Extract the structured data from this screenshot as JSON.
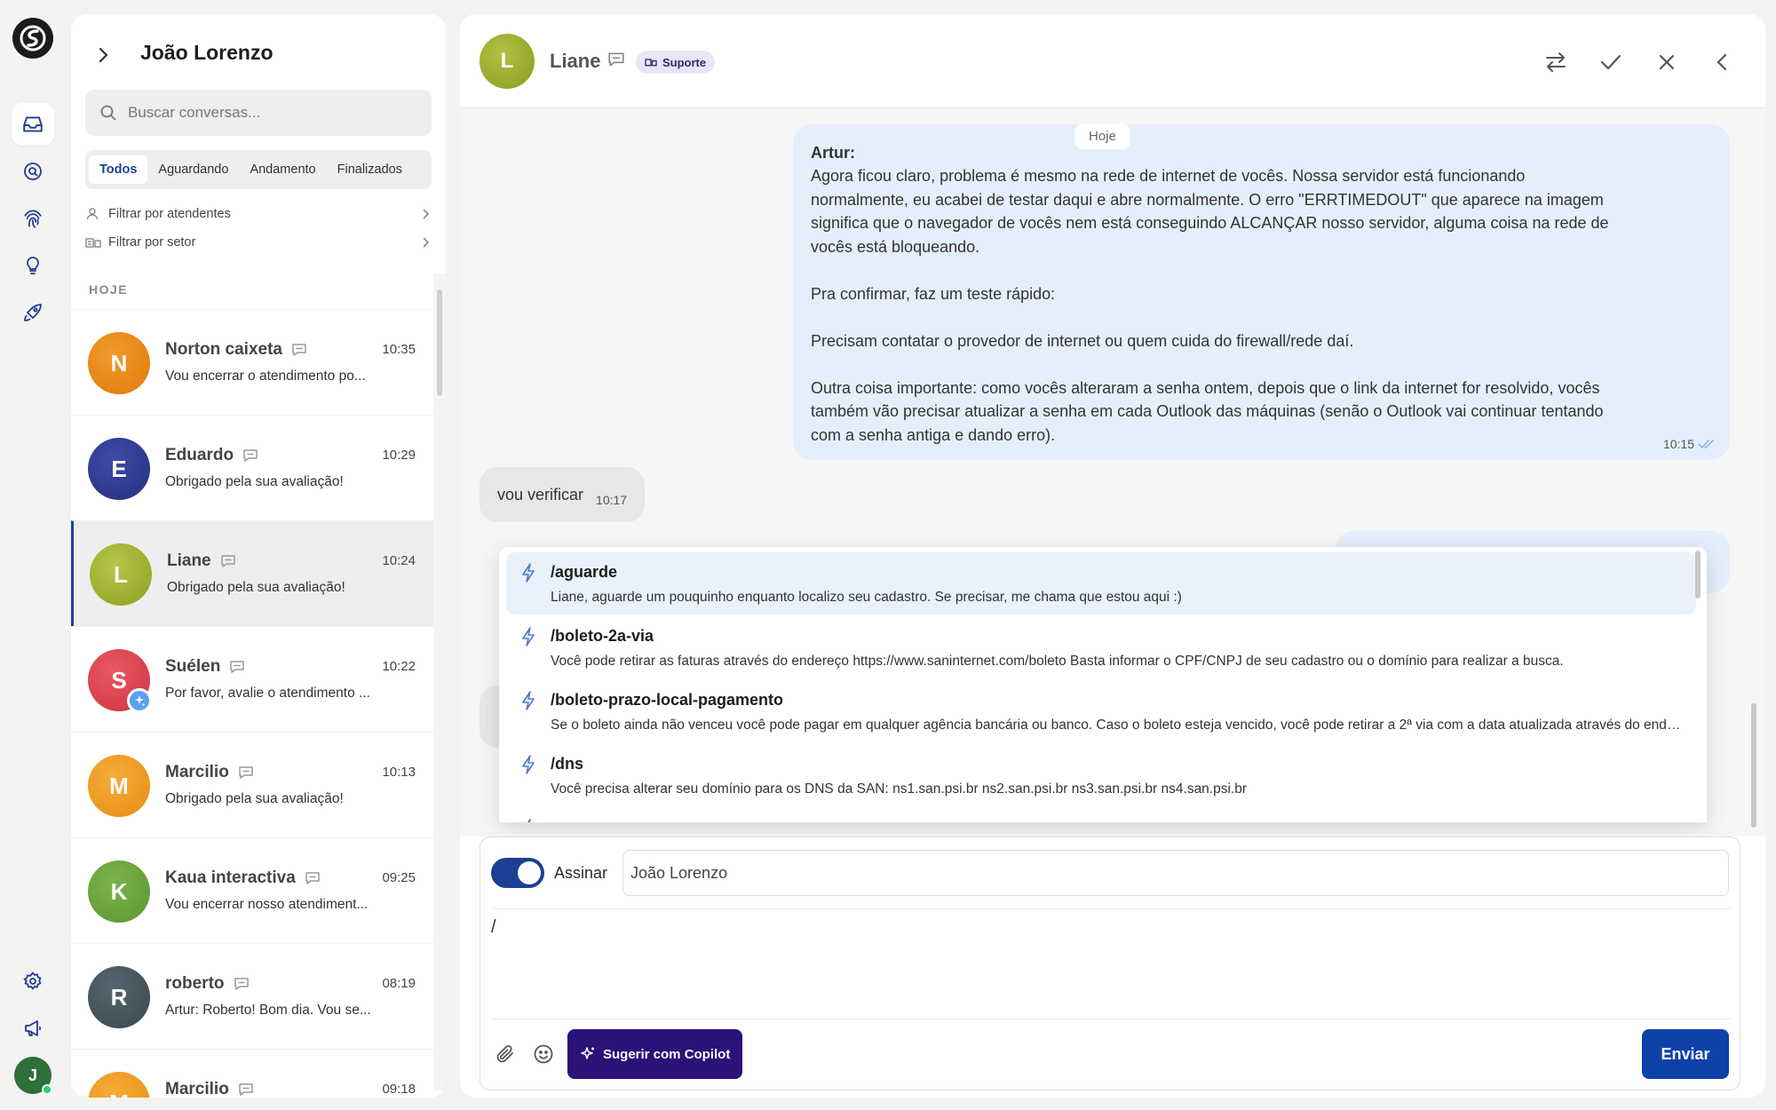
{
  "sidebar": {
    "logo_icon": "brand-logo-icon",
    "nav": [
      {
        "name": "inbox-icon",
        "active": true
      },
      {
        "name": "search-icon",
        "active": false
      },
      {
        "name": "fingerprint-icon",
        "active": false
      },
      {
        "name": "lightbulb-icon",
        "active": false
      },
      {
        "name": "rocket-icon",
        "active": false
      }
    ],
    "bottom": [
      {
        "name": "settings-icon"
      },
      {
        "name": "megaphone-icon"
      }
    ],
    "user_initial": "J"
  },
  "conversations": {
    "title": "João Lorenzo",
    "search_placeholder": "Buscar conversas...",
    "tabs": [
      "Todos",
      "Aguardando",
      "Andamento",
      "Finalizados"
    ],
    "active_tab": 0,
    "filters": [
      "Filtrar por atendentes",
      "Filtrar por setor"
    ],
    "section": "HOJE",
    "items": [
      {
        "initial": "N",
        "name": "Norton caixeta",
        "time": "10:35",
        "preview": "Vou encerrar o atendimento po...",
        "color": "#e8800f"
      },
      {
        "initial": "E",
        "name": "Eduardo",
        "time": "10:29",
        "preview": "Obrigado pela sua avaliação!",
        "color": "#2f3a92"
      },
      {
        "initial": "L",
        "name": "Liane",
        "time": "10:24",
        "preview": "Obrigado pela sua avaliação!",
        "color": "#a3b32c",
        "selected": true
      },
      {
        "initial": "S",
        "name": "Suélen",
        "time": "10:22",
        "preview": "Por favor, avalie o atendimento ...",
        "color": "#dc4450",
        "badge": true
      },
      {
        "initial": "M",
        "name": "Marcilio",
        "time": "10:13",
        "preview": "Obrigado pela sua avaliação!",
        "color": "#ef9a1c"
      },
      {
        "initial": "K",
        "name": "Kaua interactiva",
        "time": "09:25",
        "preview": "Vou encerrar nosso atendiment...",
        "color": "#6aa53c"
      },
      {
        "initial": "R",
        "name": "roberto",
        "time": "08:19",
        "preview": "Artur: Roberto! Bom dia. Vou se...",
        "color": "#46545e"
      },
      {
        "initial": "M",
        "name": "Marcilio",
        "time": "09:18",
        "preview": "",
        "color": "#ef9a1c"
      }
    ]
  },
  "chat": {
    "contact_initial": "L",
    "contact_name": "Liane",
    "sector": "Suporte",
    "day_chip": "Hoje",
    "message_author": "Artur:",
    "message_lines": [
      "Agora ficou claro, problema é mesmo na rede de internet de vocês. Nossa servidor está funcionando",
      "normalmente, eu acabei de testar daqui e abre normalmente. O erro \"ERRTIMEDOUT\" que aparece na imagem",
      "significa que o navegador de vocês nem está conseguindo ALCANÇAR nosso servidor, alguma coisa na rede de",
      "vocês está bloqueando.",
      "",
      "Pra confirmar, faz um teste rápido:",
      "",
      "Precisam contatar o provedor de internet ou quem cuida do firewall/rede daí.",
      "",
      "Outra coisa importante: como vocês alteraram a senha ontem, depois que o link da internet for resolvido, vocês",
      "também vão precisar atualizar a senha em cada Outlook das máquinas (senão o Outlook vai continuar tentando",
      "com a senha antiga e dando erro)."
    ],
    "message_time": "10:15",
    "reply_text": "vou verificar",
    "reply_time": "10:17",
    "quick_replies": [
      {
        "cmd": "/aguarde",
        "desc": "Liane, aguarde um pouquinho enquanto localizo seu cadastro. Se precisar, me chama que estou aqui :)"
      },
      {
        "cmd": "/boleto-2a-via",
        "desc": "Você pode retirar as faturas através do endereço https://www.saninternet.com/boleto Basta informar o CPF/CNPJ de seu cadastro ou o domínio para realizar a busca."
      },
      {
        "cmd": "/boleto-prazo-local-pagamento",
        "desc": "Se o boleto ainda não venceu você pode pagar em qualquer agência bancária ou banco. Caso o boleto esteja vencido, você pode retirar a 2ª via com a data atualizada através do endereço https://www.saninternet.com/boleto"
      },
      {
        "cmd": "/dns",
        "desc": "Você precisa alterar seu domínio para os DNS da SAN: ns1.san.psi.br ns2.san.psi.br ns3.san.psi.br ns4.san.psi.br"
      }
    ],
    "composer": {
      "sign_label": "Assinar",
      "sign_name": "João Lorenzo",
      "text": "/",
      "copilot_label": "Sugerir com Copilot",
      "send_label": "Enviar"
    }
  }
}
